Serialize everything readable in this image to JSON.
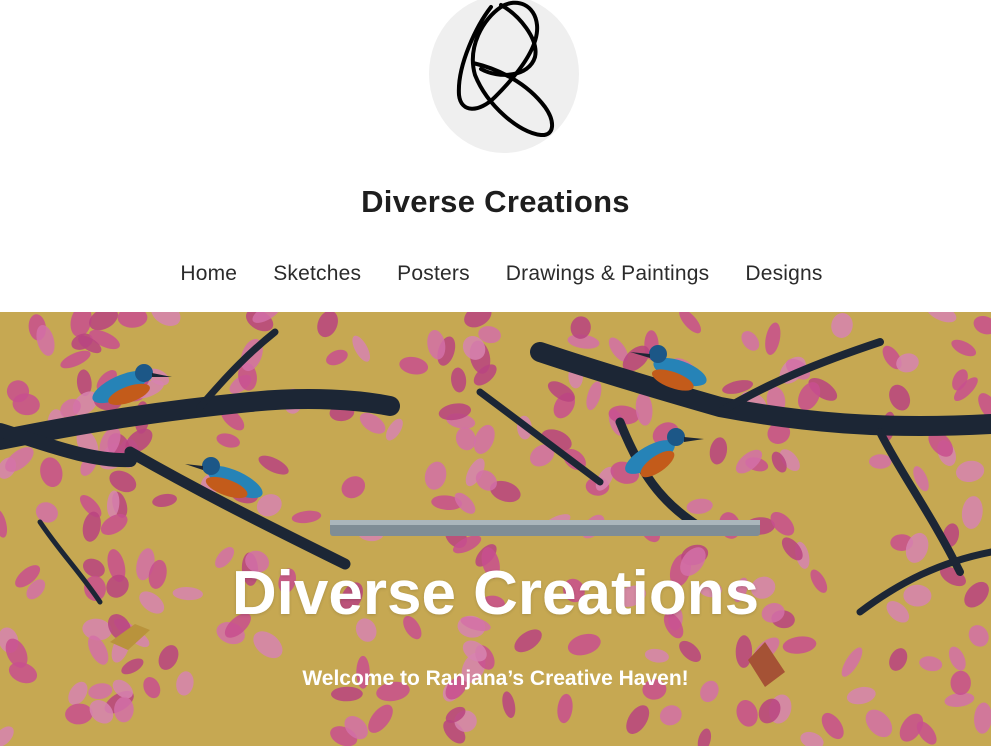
{
  "site": {
    "logo_icon": "signature-R-logo",
    "title": "Diverse Creations"
  },
  "nav": {
    "items": [
      {
        "label": "Home"
      },
      {
        "label": "Sketches"
      },
      {
        "label": "Posters"
      },
      {
        "label": "Drawings & Paintings"
      },
      {
        "label": "Designs"
      }
    ]
  },
  "hero": {
    "title": "Diverse Creations",
    "subtitle": "Welcome to Ranjana’s Creative Haven!",
    "image": "painting-kingfishers-on-branches",
    "colors": {
      "background": "#d7b75a",
      "leaves": "#d9569b",
      "branches": "#1f2a3a"
    }
  }
}
